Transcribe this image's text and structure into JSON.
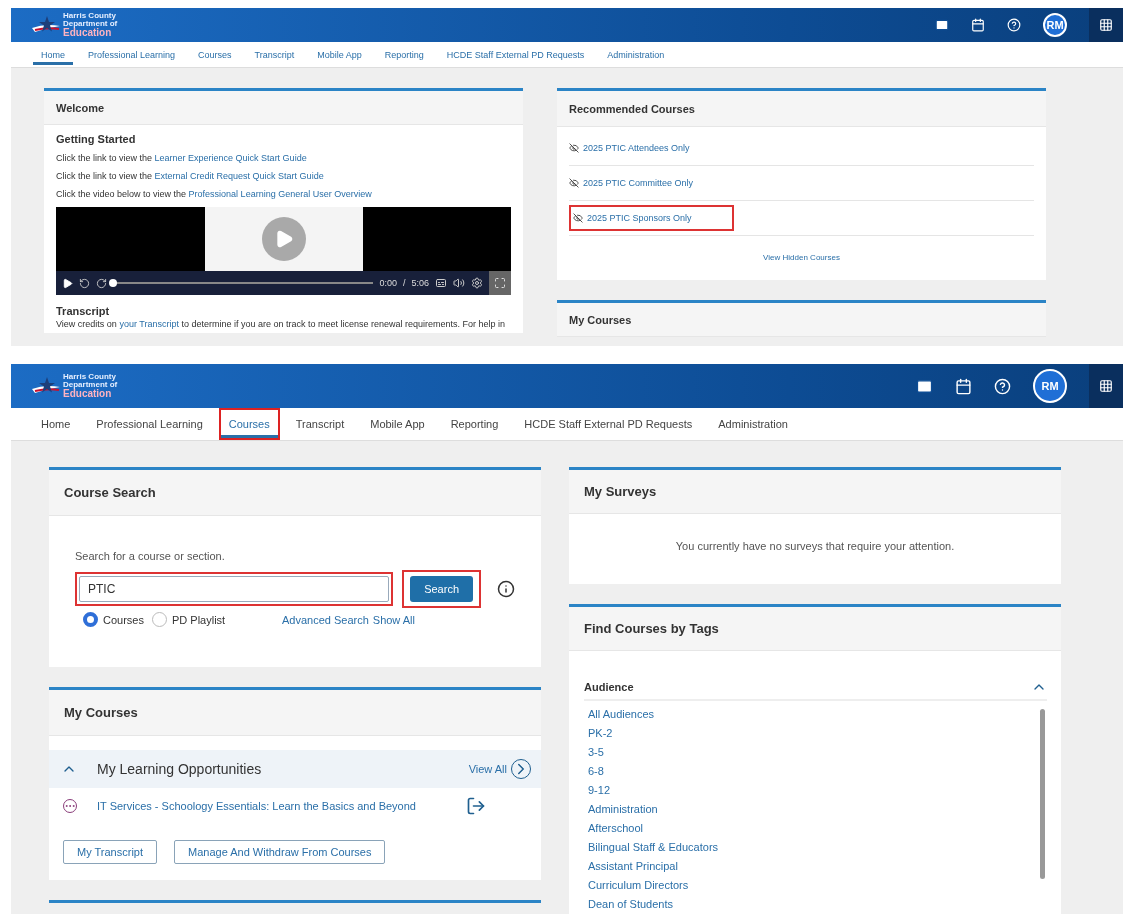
{
  "home_screen": {
    "header": {
      "logo_lines": [
        "Harris County",
        "Department of",
        "Education"
      ],
      "avatar": "RM"
    },
    "nav": [
      {
        "label": "Home",
        "selected": true,
        "highlighted": false
      },
      {
        "label": "Professional Learning",
        "selected": false,
        "highlighted": false
      },
      {
        "label": "Courses",
        "selected": false,
        "highlighted": false
      },
      {
        "label": "Transcript",
        "selected": false,
        "highlighted": false
      },
      {
        "label": "Mobile App",
        "selected": false,
        "highlighted": false
      },
      {
        "label": "Reporting",
        "selected": false,
        "highlighted": false
      },
      {
        "label": "HCDE Staff External PD Requests",
        "selected": false,
        "highlighted": false
      },
      {
        "label": "Administration",
        "selected": false,
        "highlighted": false
      }
    ],
    "welcome": {
      "title": "Welcome",
      "heading": "Getting Started",
      "lines": [
        {
          "text": "Click the link to view the",
          "link": "Learner Experience Quick Start Guide"
        },
        {
          "text": "Click the link to view the",
          "link": "External Credit Request Quick Start Guide"
        },
        {
          "text": "Click the video below to view the",
          "link": "Professional Learning General User Overview"
        }
      ],
      "video": {
        "level": 0,
        "time": "0:00",
        "separator": "/",
        "duration": "5:06"
      },
      "transcript_heading": "Transcript",
      "transcript_line": {
        "text": "View credits on",
        "link": "your Transcript",
        "rest": "to determine if you are on track to meet license renewal requirements. For help in"
      }
    },
    "recommended": {
      "title": "Recommended Courses",
      "courses": [
        {
          "name": "2025 PTIC Attendees Only",
          "highlighted": false
        },
        {
          "name": "2025 PTIC Committee Only",
          "highlighted": false
        },
        {
          "name": "2025 PTIC Sponsors Only",
          "highlighted": true
        }
      ],
      "link": "View Hidden Courses"
    },
    "my_courses_title": "My Courses"
  },
  "courses_screen": {
    "header": {
      "logo_lines": [
        "Harris County",
        "Department of",
        "Education"
      ],
      "avatar": "RM"
    },
    "nav": [
      {
        "label": "Home",
        "selected": false,
        "highlighted": false
      },
      {
        "label": "Professional Learning",
        "selected": false,
        "highlighted": false
      },
      {
        "label": "Courses",
        "selected": true,
        "highlighted": true
      },
      {
        "label": "Transcript",
        "selected": false,
        "highlighted": false
      },
      {
        "label": "Mobile App",
        "selected": false,
        "highlighted": false
      },
      {
        "label": "Reporting",
        "selected": false,
        "highlighted": false
      },
      {
        "label": "HCDE Staff External PD Requests",
        "selected": false,
        "highlighted": false
      },
      {
        "label": "Administration",
        "selected": false,
        "highlighted": false
      }
    ],
    "course_search": {
      "title": "Course Search",
      "prompt": "Search for a course or section.",
      "query": {
        "value": "PTIC",
        "highlighted": true
      },
      "button": {
        "label": "Search",
        "highlighted": true
      },
      "options": [
        {
          "label": "Courses",
          "selected": true
        },
        {
          "label": "PD Playlist",
          "selected": false
        }
      ],
      "links": [
        "Advanced Search",
        "Show All"
      ]
    },
    "my_courses": {
      "title": "My Courses",
      "section": {
        "title": "My Learning Opportunities",
        "expanded": true,
        "view_all": "View All"
      },
      "items": [
        "IT Services - Schoology Essentials: Learn the Basics and Beyond"
      ],
      "buttons": [
        "My Transcript",
        "Manage And Withdraw From Courses"
      ]
    },
    "surveys": {
      "title": "My Surveys",
      "message": "You currently have no surveys that require your attention."
    },
    "tags": {
      "title": "Find Courses by Tags",
      "group": {
        "name": "Audience",
        "expanded": true,
        "tags": [
          "All Audiences",
          "PK-2",
          "3-5",
          "6-8",
          "9-12",
          "Administration",
          "Afterschool",
          "Bilingual Staff & Educators",
          "Assistant Principal",
          "Curriculum Directors",
          "Dean of Students"
        ]
      }
    }
  }
}
